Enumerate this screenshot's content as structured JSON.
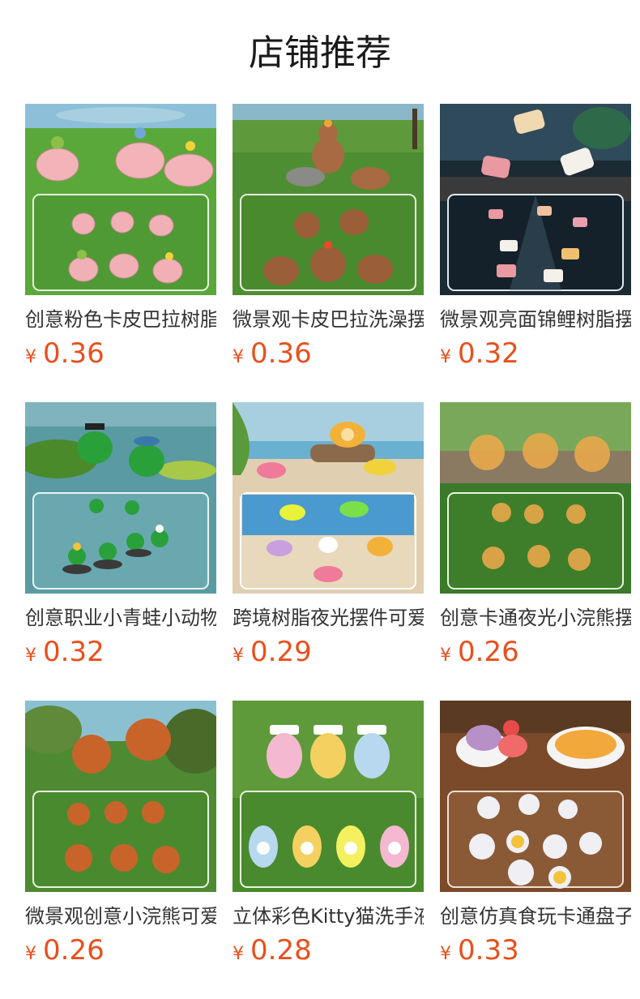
{
  "section_title": "店铺推荐",
  "currency_symbol": "¥",
  "products": [
    {
      "name": "创意粉色卡皮巴拉树脂摆件",
      "price": "0.36",
      "image": "pink-capybara-figurines"
    },
    {
      "name": "微景观卡皮巴拉洗澡摆件",
      "price": "0.36",
      "image": "brown-capybara-figurines"
    },
    {
      "name": "微景观亮面锦鲤树脂摆件",
      "price": "0.32",
      "image": "koi-fish-figurines"
    },
    {
      "name": "创意职业小青蛙小动物摆件",
      "price": "0.32",
      "image": "green-frog-figurines"
    },
    {
      "name": "跨境树脂夜光摆件可爱",
      "price": "0.29",
      "image": "beach-float-figurines"
    },
    {
      "name": "创意卡通夜光小浣熊摆件",
      "price": "0.26",
      "image": "glow-raccoon-figurines"
    },
    {
      "name": "微景观创意小浣熊可爱摆件",
      "price": "0.26",
      "image": "red-panda-figurines"
    },
    {
      "name": "立体彩色Kitty猫洗手液摆件",
      "price": "0.28",
      "image": "kitty-bottle-figurines"
    },
    {
      "name": "创意仿真食玩卡通盘子摆件",
      "price": "0.33",
      "image": "food-plate-figurines"
    }
  ],
  "colors": {
    "price": "#e8501d",
    "text": "#333333",
    "title": "#1a1a1a"
  }
}
